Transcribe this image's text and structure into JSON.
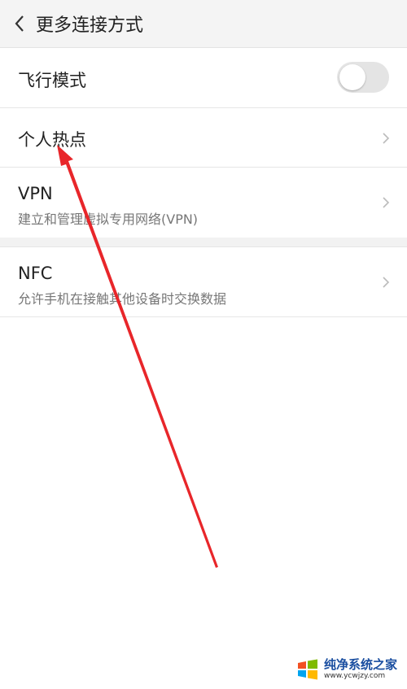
{
  "header": {
    "title": "更多连接方式",
    "back_icon": "chevron-left-icon"
  },
  "items": [
    {
      "label": "飞行模式",
      "toggle_on": false
    },
    {
      "label": "个人热点"
    },
    {
      "label": "VPN",
      "subtitle": "建立和管理虚拟专用网络(VPN)"
    },
    {
      "label": "NFC",
      "subtitle": "允许手机在接触其他设备时交换数据"
    }
  ],
  "annotation": {
    "arrow_color": "#e8262a"
  },
  "watermark": {
    "title": "纯净系统之家",
    "url": "www.ycwjzy.com"
  }
}
